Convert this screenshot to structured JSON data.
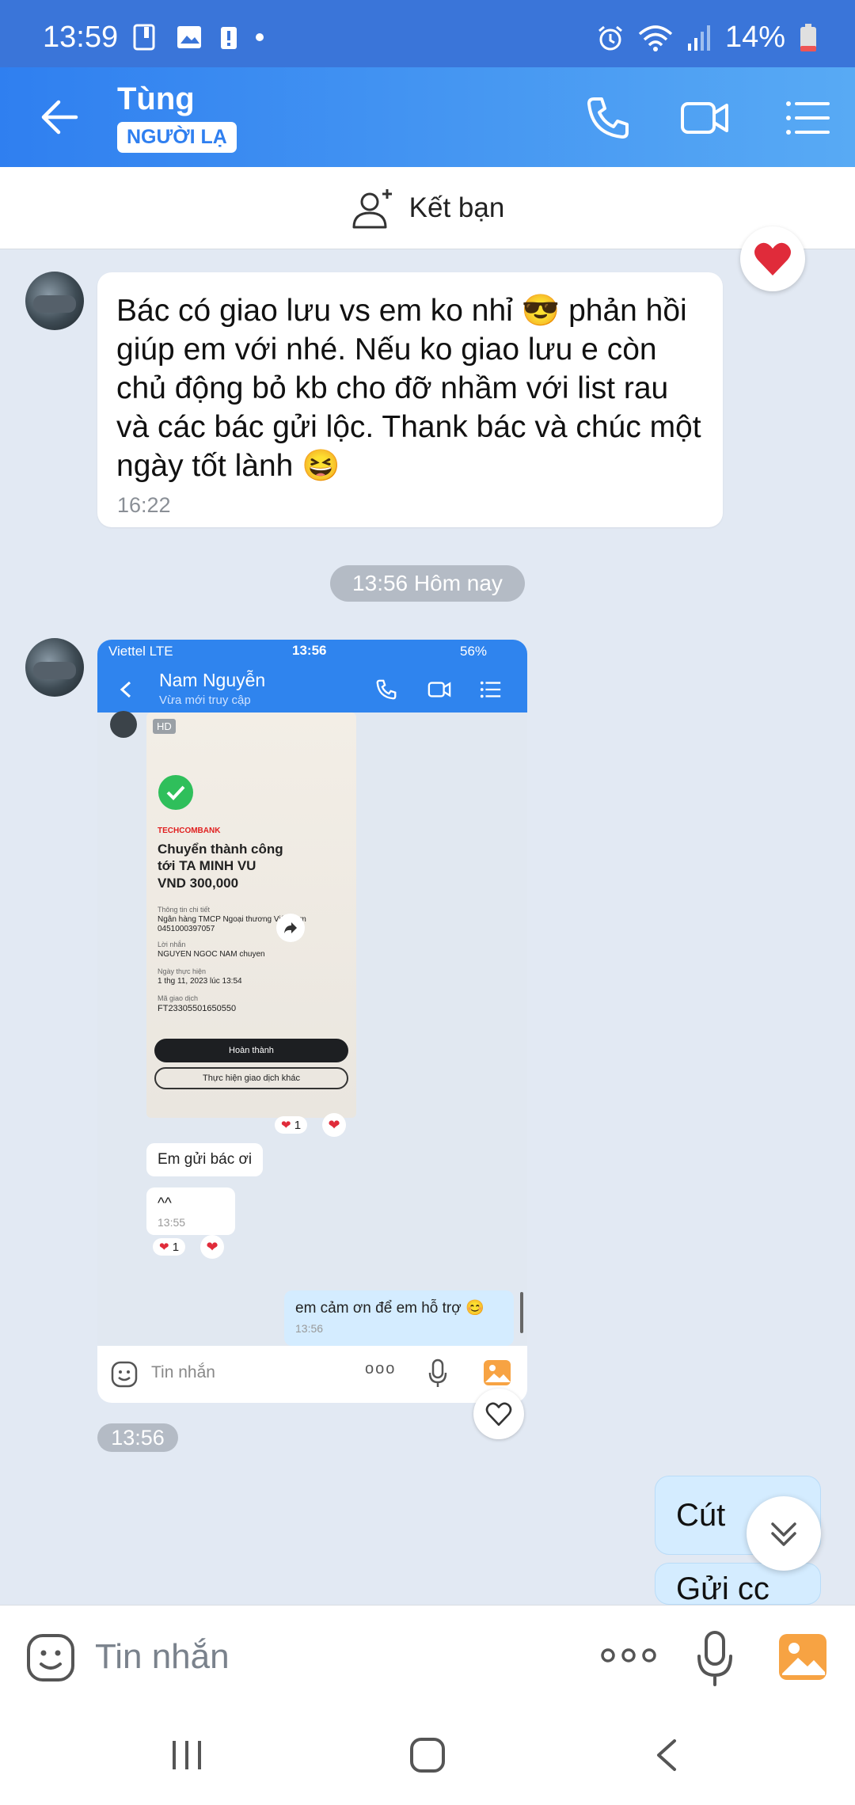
{
  "status_bar": {
    "time": "13:59",
    "battery": "14%"
  },
  "header": {
    "name": "Tùng",
    "badge": "NGƯỜI LẠ"
  },
  "add_friend": {
    "label": "Kết bạn"
  },
  "messages": {
    "first": {
      "text": "Bác có giao lưu vs em ko nhỉ 😎 phản hồi giúp em với nhé. Nếu ko giao lưu e còn chủ động bỏ kb cho đỡ nhầm với list rau và các bác gửi lộc. Thank bác và chúc một ngày tốt lành 😆",
      "time": "16:22"
    },
    "date_separator": "13:56 Hôm nay",
    "image_time": "13:56",
    "out1": "Cút",
    "out2": "Gửi cc"
  },
  "screenshot": {
    "carrier": "Viettel  LTE",
    "time": "13:56",
    "battery": "56%",
    "contact": "Nam Nguyễn",
    "subtitle": "Vừa mới truy cập",
    "hd": "HD",
    "bank": "TECHCOMBANK",
    "transfer_title": "Chuyển thành công tới TA MINH VU",
    "amount": "VND 300,000",
    "detail_label": "Thông tin chi tiết",
    "bank_name": "Ngân hàng TMCP Ngoại thương Việt Nam",
    "account": "0451000397057",
    "note_label": "Lời nhắn",
    "note": "NGUYEN NGOC NAM chuyen",
    "date_label": "Ngày thực hiện",
    "date": "1 thg 11, 2023 lúc 13:54",
    "code_label": "Mã giao dịch",
    "code": "FT23305501650550",
    "done_btn": "Hoàn thành",
    "other_btn": "Thực hiện giao dịch khác",
    "reaction_count": "1",
    "msg_gui": "Em gửi bác ơi",
    "msg_caret": "^^",
    "msg_caret_time": "13:55",
    "reaction_count2": "1",
    "msg_thanks": "em cảm ơn để em hỗ trợ 😊",
    "msg_thanks_time": "13:56",
    "input_placeholder": "Tin nhắn"
  },
  "input": {
    "placeholder": "Tin nhắn"
  }
}
